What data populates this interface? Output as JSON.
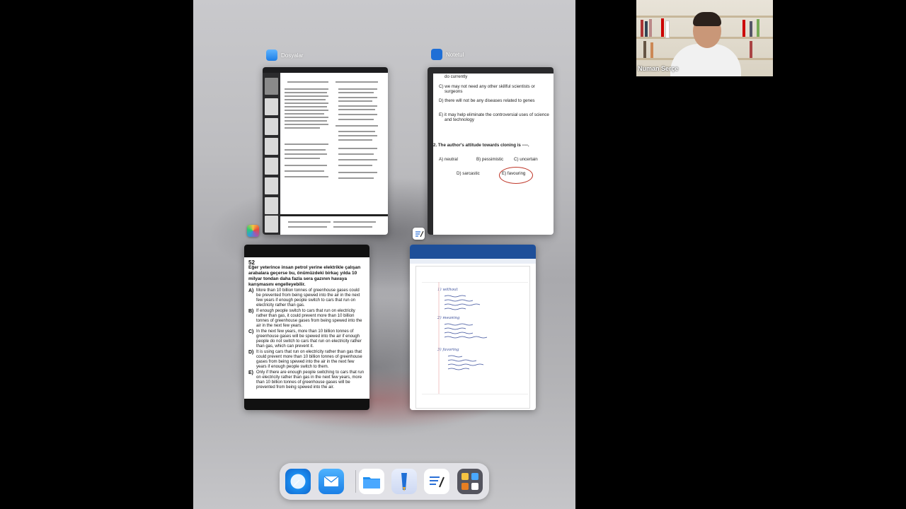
{
  "webcam": {
    "name": "Numan Serçe"
  },
  "app_switcher": {
    "apps": [
      {
        "name": "Dosyalar",
        "icon": "files-icon"
      },
      {
        "name": "Notetul",
        "icon": "notetul-icon"
      },
      {
        "name": "",
        "icon": "photos-icon"
      },
      {
        "name": "",
        "icon": "goodnotes-icon"
      }
    ]
  },
  "notes_card": {
    "lines": [
      "do currently",
      "C) we may not need any other skillful scientists or",
      "surgeons",
      "D) there will not be any diseases related to genes",
      "E) it may help eliminate the controversial uses of science",
      "and technology"
    ],
    "question": "2.  The author's attitude towards cloning is ----.",
    "options": [
      "A) neutral",
      "B) pessimistic",
      "C) uncertain",
      "D) sarcastic",
      "E) favouring"
    ]
  },
  "question_card": {
    "number": "52",
    "stem": "Eğer yeterince insan petrol yerine elektrikle çalışan arabalara geçerse bu, önümüzdeki birkaç yılda 10 milyar tondan daha fazla sera gazının havaya karışmasını engelleyebilir.",
    "options": [
      {
        "letter": "A)",
        "text": "More than 10 billion tonnes of greenhouse gases could be prevented from being spewed into the air in the next few years if enough people switch to cars that run on electricity rather than gas."
      },
      {
        "letter": "B)",
        "text": "If enough people switch to cars that run on electricity rather than gas, it could prevent more than 10 billion tonnes of greenhouse gases from being spewed into the air in the next few years."
      },
      {
        "letter": "C)",
        "text": "In the next few years, more than 10 billion tonnes of greenhouse gases will be spewed into the air if enough people do not switch to cars that run on electricity rather than gas, which can prevent it."
      },
      {
        "letter": "D)",
        "text": "It is using cars that run on electricity rather than gas that could prevent more than 10 billion tonnes of greenhouse gases from being spewed into the air in the next few years if enough people switch to them."
      },
      {
        "letter": "E)",
        "text": "Only if there are enough people switching to cars that run on electricity rather than gas in the next few years, more than 10 billion tonnes of greenhouse gases will be prevented from being spewed into the air."
      }
    ]
  },
  "goodnotes_card": {
    "notes": [
      "1) without",
      "2) meaning",
      "3) favoring"
    ]
  },
  "dock": {
    "apps": [
      "safari-icon",
      "mail-icon",
      "files-icon",
      "notetul-icon",
      "goodnotes-icon",
      "app-library-icon"
    ]
  }
}
